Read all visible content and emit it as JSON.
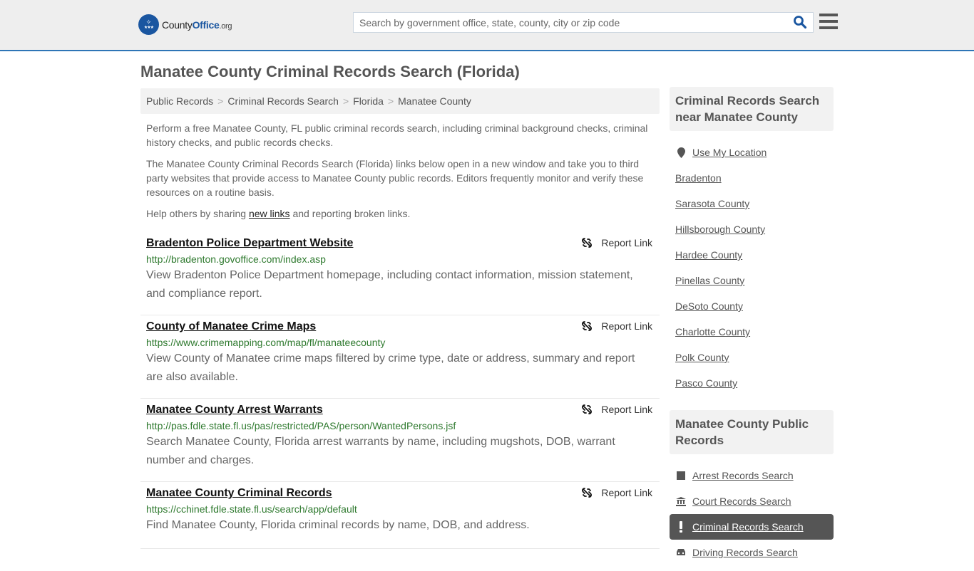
{
  "header": {
    "logo_main": "County",
    "logo_accent": "Office",
    "logo_suffix": ".org",
    "search_placeholder": "Search by government office, state, county, city or zip code",
    "search_value": ""
  },
  "page": {
    "title": "Manatee County Criminal Records Search (Florida)"
  },
  "breadcrumb": [
    {
      "label": "Public Records"
    },
    {
      "label": "Criminal Records Search"
    },
    {
      "label": "Florida"
    },
    {
      "label": "Manatee County"
    }
  ],
  "intro": {
    "p1": "Perform a free Manatee County, FL public criminal records search, including criminal background checks, criminal history checks, and public records checks.",
    "p2": "The Manatee County Criminal Records Search (Florida) links below open in a new window and take you to third party websites that provide access to Manatee County public records. Editors frequently monitor and verify these resources on a routine basis.",
    "p3_before": "Help others by sharing ",
    "p3_link": "new links",
    "p3_after": " and reporting broken links."
  },
  "results": [
    {
      "title": "Bradenton Police Department Website",
      "url": "http://bradenton.govoffice.com/index.asp",
      "description": "View Bradenton Police Department homepage, including contact information, mission statement, and compliance report.",
      "report_label": "Report Link"
    },
    {
      "title": "County of Manatee Crime Maps",
      "url": "https://www.crimemapping.com/map/fl/manateecounty",
      "description": "View County of Manatee crime maps filtered by crime type, date or address, summary and report are also available.",
      "report_label": "Report Link"
    },
    {
      "title": "Manatee County Arrest Warrants",
      "url": "http://pas.fdle.state.fl.us/pas/restricted/PAS/person/WantedPersons.jsf",
      "description": "Search Manatee County, Florida arrest warrants by name, including mugshots, DOB, warrant number and charges.",
      "report_label": "Report Link"
    },
    {
      "title": "Manatee County Criminal Records",
      "url": "https://cchinet.fdle.state.fl.us/search/app/default",
      "description": "Find Manatee County, Florida criminal records by name, DOB, and address.",
      "report_label": "Report Link"
    }
  ],
  "sidebar": {
    "nearby_heading": "Criminal Records Search near Manatee County",
    "use_location": "Use My Location",
    "nearby": [
      "Bradenton",
      "Sarasota County",
      "Hillsborough County",
      "Hardee County",
      "Pinellas County",
      "DeSoto County",
      "Charlotte County",
      "Polk County",
      "Pasco County"
    ],
    "public_heading": "Manatee County Public Records",
    "public_records": [
      {
        "label": "Arrest Records Search",
        "icon": "square-icon",
        "active": false
      },
      {
        "label": "Court Records Search",
        "icon": "courthouse-icon",
        "active": false
      },
      {
        "label": "Criminal Records Search",
        "icon": "exclamation-icon",
        "active": true
      },
      {
        "label": "Driving Records Search",
        "icon": "car-icon",
        "active": false
      }
    ]
  },
  "colors": {
    "brand_blue": "#1a56a0",
    "url_green": "#2f7a2f",
    "active_bg": "#555555"
  }
}
